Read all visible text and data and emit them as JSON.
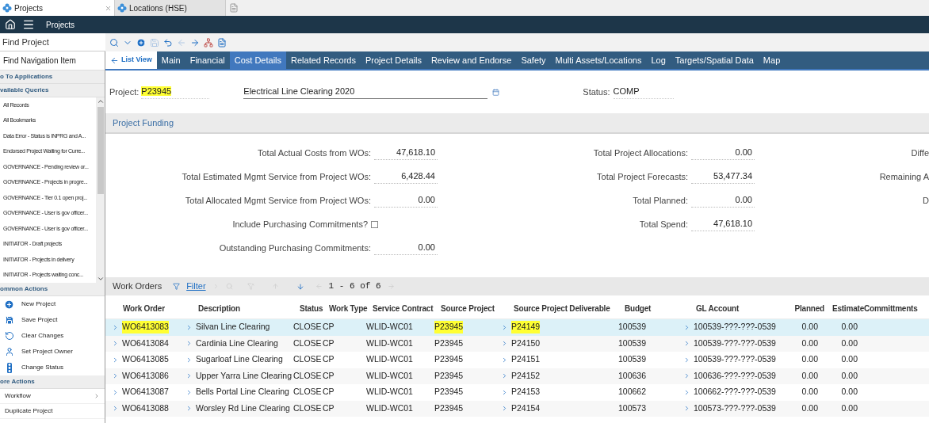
{
  "browser_tabs": [
    {
      "label": "Projects",
      "selected": true
    },
    {
      "label": "Locations (HSE)",
      "selected": false
    }
  ],
  "app_bar": {
    "title": "Projects"
  },
  "find_field": {
    "placeholder": "Find Project"
  },
  "sidebar": {
    "search_placeholder": "Find Navigation Item",
    "sections": [
      {
        "title": "o To Applications"
      },
      {
        "title": "vailable Queries",
        "kind": "queries",
        "items": [
          {
            "label": "All Records"
          },
          {
            "label": "All Bookmarks"
          },
          {
            "label": "Data Error - Status is INPRG and A..."
          },
          {
            "label": "Endorsed Project Waiting for Curre..."
          },
          {
            "label": "GOVERNANCE - Pending review or..."
          },
          {
            "label": "GOVERNANCE - Projects in progre..."
          },
          {
            "label": "GOVERNANCE - Tier 0.1 open proj..."
          },
          {
            "label": "GOVERNANCE - User is gov officer..."
          },
          {
            "label": "GOVERNANCE - User is gov officer..."
          },
          {
            "label": "INITIATOR - Draft projects"
          },
          {
            "label": "INITIATOR - Projects in delivery"
          },
          {
            "label": "INITIATOR - Projects waiting conc..."
          }
        ]
      },
      {
        "title": "ommon Actions",
        "kind": "actions",
        "items": [
          {
            "label": "New Project"
          },
          {
            "label": "Save Project"
          },
          {
            "label": "Clear Changes"
          },
          {
            "label": "Set Project Owner"
          },
          {
            "label": "Change Status"
          }
        ]
      },
      {
        "title": "ore Actions",
        "kind": "more",
        "items": [
          {
            "label": "Workflow",
            "submenu": true
          },
          {
            "label": "Duplicate Project",
            "submenu": false
          }
        ]
      }
    ]
  },
  "tabs": [
    {
      "label": "List View",
      "kind": "back",
      "selected": false
    },
    {
      "label": "Main",
      "kind": "tab",
      "selected": false
    },
    {
      "label": "Financial",
      "kind": "tab",
      "selected": false
    },
    {
      "label": "Cost Details",
      "kind": "tab",
      "selected": true
    },
    {
      "label": "Related Records",
      "kind": "tab",
      "selected": false
    },
    {
      "label": "Project Details",
      "kind": "tab",
      "selected": false
    },
    {
      "label": "Review and Endorse",
      "kind": "tab",
      "selected": false
    },
    {
      "label": "Safety",
      "kind": "tab",
      "selected": false
    },
    {
      "label": "Multi Assets/Locations",
      "kind": "tab",
      "selected": false
    },
    {
      "label": "Log",
      "kind": "tab",
      "selected": false
    },
    {
      "label": "Targets/Spatial Data",
      "kind": "tab",
      "selected": false
    },
    {
      "label": "Map",
      "kind": "tab",
      "selected": false
    }
  ],
  "project": {
    "label": "Project:",
    "id": "P23945",
    "id_highlighted": true,
    "description": "Electrical Line Clearing 2020",
    "status_label": "Status:",
    "status": "COMP"
  },
  "funding": {
    "title": "Project Funding",
    "columns": [
      [
        {
          "kind": "value",
          "label": "Total Actual Costs from WOs:",
          "value": "47,618.10"
        },
        {
          "kind": "value",
          "label": "Total Estimated Mgmt Service from Project WOs:",
          "value": "6,428.44"
        },
        {
          "kind": "value",
          "label": "Total Allocated Mgmt Service from Project WOs:",
          "value": "0.00"
        },
        {
          "kind": "checkbox",
          "label": "Include Purchasing Commitments?",
          "checked": false
        },
        {
          "kind": "value",
          "label": "Outstanding Purchasing Commitments:",
          "value": "0.00"
        }
      ],
      [
        {
          "kind": "value",
          "label": "Total Project Allocations:",
          "value": "0.00"
        },
        {
          "kind": "value",
          "label": "Total Project Forecasts:",
          "value": "53,477.34"
        },
        {
          "kind": "value",
          "label": "Total Planned:",
          "value": "0.00"
        },
        {
          "kind": "value",
          "label": "Total Spend:",
          "value": "47,618.10"
        }
      ],
      [
        {
          "kind": "label",
          "label": "Diffe"
        },
        {
          "kind": "label",
          "label": "Remaining A"
        },
        {
          "kind": "label",
          "label": "D"
        }
      ]
    ]
  },
  "work_orders": {
    "title": "Work Orders",
    "filter": "Filter",
    "pager": "1 - 6 of 6",
    "columns": [
      "Work Order",
      "Description",
      "Status",
      "Work Type",
      "Service Contract",
      "Source Project",
      "Source Project Deliverable",
      "Budget",
      "GL Account",
      "Planned",
      "Estimate",
      "Committments"
    ],
    "rows": [
      {
        "selected": true,
        "cells": [
          {
            "text": "WO6413083",
            "highlighted": true
          },
          {
            "text": "Silvan Line Clearing",
            "highlighted": false
          },
          {
            "text": "CLOSE",
            "highlighted": false
          },
          {
            "text": "CP",
            "highlighted": false
          },
          {
            "text": "WLID-WC01",
            "highlighted": false
          },
          {
            "text": "P23945",
            "highlighted": true
          },
          {
            "text": "P24149",
            "highlighted": true
          },
          {
            "text": "100539",
            "highlighted": false
          },
          {
            "text": "100539-???-???-0539",
            "highlighted": false
          },
          {
            "text": "0.00",
            "highlighted": false
          },
          {
            "text": "0.00",
            "highlighted": false
          }
        ]
      },
      {
        "selected": false,
        "cells": [
          {
            "text": "WO6413084",
            "highlighted": false
          },
          {
            "text": "Cardinia Line Clearing",
            "highlighted": false
          },
          {
            "text": "CLOSE",
            "highlighted": false
          },
          {
            "text": "CP",
            "highlighted": false
          },
          {
            "text": "WLID-WC01",
            "highlighted": false
          },
          {
            "text": "P23945",
            "highlighted": false
          },
          {
            "text": "P24150",
            "highlighted": false
          },
          {
            "text": "100539",
            "highlighted": false
          },
          {
            "text": "100539-???-???-0539",
            "highlighted": false
          },
          {
            "text": "0.00",
            "highlighted": false
          },
          {
            "text": "0.00",
            "highlighted": false
          }
        ]
      },
      {
        "selected": false,
        "cells": [
          {
            "text": "WO6413085",
            "highlighted": false
          },
          {
            "text": "Sugarloaf Line Clearing",
            "highlighted": false
          },
          {
            "text": "CLOSE",
            "highlighted": false
          },
          {
            "text": "CP",
            "highlighted": false
          },
          {
            "text": "WLID-WC01",
            "highlighted": false
          },
          {
            "text": "P23945",
            "highlighted": false
          },
          {
            "text": "P24151",
            "highlighted": false
          },
          {
            "text": "100539",
            "highlighted": false
          },
          {
            "text": "100539-???-???-0539",
            "highlighted": false
          },
          {
            "text": "0.00",
            "highlighted": false
          },
          {
            "text": "0.00",
            "highlighted": false
          }
        ]
      },
      {
        "selected": false,
        "cells": [
          {
            "text": "WO6413086",
            "highlighted": false
          },
          {
            "text": "Upper Yarra Line Clearing",
            "highlighted": false
          },
          {
            "text": "CLOSE",
            "highlighted": false
          },
          {
            "text": "CP",
            "highlighted": false
          },
          {
            "text": "WLID-WC01",
            "highlighted": false
          },
          {
            "text": "P23945",
            "highlighted": false
          },
          {
            "text": "P24152",
            "highlighted": false
          },
          {
            "text": "100636",
            "highlighted": false
          },
          {
            "text": "100636-???-???-0539",
            "highlighted": false
          },
          {
            "text": "0.00",
            "highlighted": false
          },
          {
            "text": "0.00",
            "highlighted": false
          }
        ]
      },
      {
        "selected": false,
        "cells": [
          {
            "text": "WO6413087",
            "highlighted": false
          },
          {
            "text": "Bells Portal Line Clearing",
            "highlighted": false
          },
          {
            "text": "CLOSE",
            "highlighted": false
          },
          {
            "text": "CP",
            "highlighted": false
          },
          {
            "text": "WLID-WC01",
            "highlighted": false
          },
          {
            "text": "P23945",
            "highlighted": false
          },
          {
            "text": "P24153",
            "highlighted": false
          },
          {
            "text": "100662",
            "highlighted": false
          },
          {
            "text": "100662-???-???-0539",
            "highlighted": false
          },
          {
            "text": "0.00",
            "highlighted": false
          },
          {
            "text": "0.00",
            "highlighted": false
          }
        ]
      },
      {
        "selected": false,
        "cells": [
          {
            "text": "WO6413088",
            "highlighted": false
          },
          {
            "text": "Worsley Rd Line Clearing",
            "highlighted": false
          },
          {
            "text": "CLOSE",
            "highlighted": false
          },
          {
            "text": "CP",
            "highlighted": false
          },
          {
            "text": "WLID-WC01",
            "highlighted": false
          },
          {
            "text": "P23945",
            "highlighted": false
          },
          {
            "text": "P24154",
            "highlighted": false
          },
          {
            "text": "100573",
            "highlighted": false
          },
          {
            "text": "100573-???-???-0539",
            "highlighted": false
          },
          {
            "text": "0.00",
            "highlighted": false
          },
          {
            "text": "0.00",
            "highlighted": false
          }
        ]
      }
    ]
  }
}
